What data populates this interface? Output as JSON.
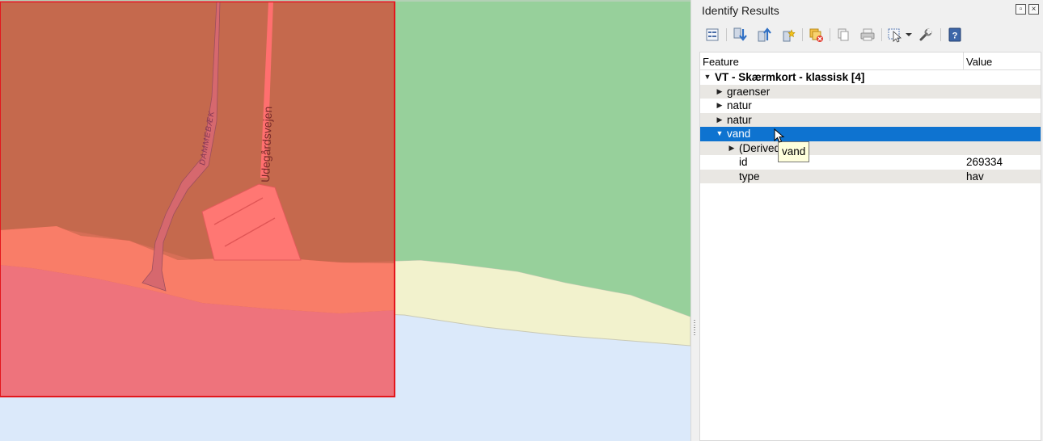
{
  "panel": {
    "title": "Identify Results",
    "float_icon": "float-icon",
    "close_icon": "close-icon"
  },
  "toolbar": {
    "buttons": [
      "expand-tree-icon",
      "expand-all-icon",
      "collapse-all-icon",
      "expand-new-results-icon",
      "clear-results-icon",
      "copy-feature-icon",
      "print-icon",
      "identify-mode-icon",
      "dropdown-arrow-icon",
      "settings-wrench-icon",
      "help-icon"
    ]
  },
  "tree": {
    "headers": {
      "feature": "Feature",
      "value": "Value"
    },
    "layer": {
      "label": "VT - Skærmkort - klassisk  [4]"
    },
    "rows": [
      {
        "label": "graenser",
        "value": ""
      },
      {
        "label": "natur",
        "value": ""
      },
      {
        "label": "natur",
        "value": ""
      },
      {
        "label": "vand",
        "value": ""
      },
      {
        "label": "(Derived)",
        "value": ""
      },
      {
        "label": "id",
        "value": "269334"
      },
      {
        "label": "type",
        "value": "hav"
      }
    ]
  },
  "tooltip": {
    "text": "vand"
  },
  "map": {
    "labels": {
      "road": "Udegårdsvejen",
      "stream": "DAMMEBÆK"
    },
    "colors": {
      "water": "#dbe9fa",
      "beach": "#f2f2cd",
      "forest": "#97d09b",
      "highlight_fill": "#e0634d",
      "highlight_border": "#e3161c",
      "selection_blue": "#0e73d0"
    }
  }
}
